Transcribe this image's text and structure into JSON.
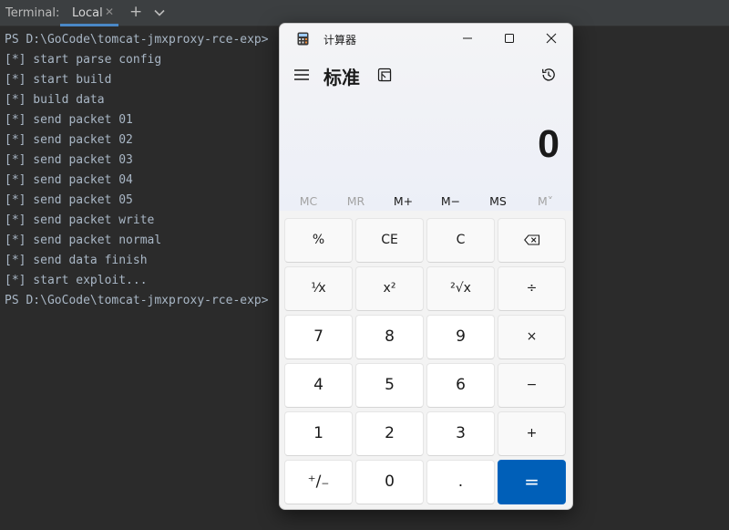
{
  "terminal": {
    "title": "Terminal:",
    "tab_label": "Local",
    "close_glyph": "✕",
    "new_tab_glyph": "+",
    "lines": [
      "PS D:\\GoCode\\tomcat-jmxproxy-rce-exp>",
      "[*] start parse config",
      "[*] start build",
      "[*] build data",
      "[*] send packet 01",
      "[*] send packet 02",
      "[*] send packet 03",
      "[*] send packet 04",
      "[*] send packet 05",
      "[*] send packet write",
      "[*] send packet normal",
      "[*] send data finish",
      "[*] start exploit...",
      "PS D:\\GoCode\\tomcat-jmxproxy-rce-exp>"
    ]
  },
  "calculator": {
    "window_title": "计算器",
    "mode": "标准",
    "display": "0",
    "memory": [
      {
        "label": "MC",
        "enabled": false
      },
      {
        "label": "MR",
        "enabled": false
      },
      {
        "label": "M+",
        "enabled": true
      },
      {
        "label": "M−",
        "enabled": true
      },
      {
        "label": "MS",
        "enabled": true
      },
      {
        "label": "M˅",
        "enabled": false
      }
    ],
    "keys": [
      {
        "label": "%",
        "kind": "fn",
        "name": "percent"
      },
      {
        "label": "CE",
        "kind": "fn",
        "name": "clear-entry"
      },
      {
        "label": "C",
        "kind": "fn",
        "name": "clear"
      },
      {
        "label": "",
        "kind": "fn",
        "name": "backspace",
        "icon": "backspace-icon"
      },
      {
        "label": "¹⁄x",
        "kind": "fn",
        "name": "reciprocal"
      },
      {
        "label": "x²",
        "kind": "fn",
        "name": "square"
      },
      {
        "label": "²√x",
        "kind": "fn",
        "name": "square-root"
      },
      {
        "label": "÷",
        "kind": "fn",
        "name": "divide"
      },
      {
        "label": "7",
        "kind": "num",
        "name": "digit-7"
      },
      {
        "label": "8",
        "kind": "num",
        "name": "digit-8"
      },
      {
        "label": "9",
        "kind": "num",
        "name": "digit-9"
      },
      {
        "label": "×",
        "kind": "fn",
        "name": "multiply"
      },
      {
        "label": "4",
        "kind": "num",
        "name": "digit-4"
      },
      {
        "label": "5",
        "kind": "num",
        "name": "digit-5"
      },
      {
        "label": "6",
        "kind": "num",
        "name": "digit-6"
      },
      {
        "label": "−",
        "kind": "fn",
        "name": "subtract"
      },
      {
        "label": "1",
        "kind": "num",
        "name": "digit-1"
      },
      {
        "label": "2",
        "kind": "num",
        "name": "digit-2"
      },
      {
        "label": "3",
        "kind": "num",
        "name": "digit-3"
      },
      {
        "label": "+",
        "kind": "fn",
        "name": "add"
      },
      {
        "label": "⁺∕₋",
        "kind": "num",
        "name": "negate"
      },
      {
        "label": "0",
        "kind": "num",
        "name": "digit-0"
      },
      {
        "label": ".",
        "kind": "num",
        "name": "decimal"
      },
      {
        "label": "=",
        "kind": "eq",
        "name": "equals"
      }
    ]
  },
  "colors": {
    "terminal_bg": "#2b2b2b",
    "terminal_text": "#a9b7c6",
    "tab_accent": "#4a88c7",
    "equals_bg": "#005fb8"
  }
}
